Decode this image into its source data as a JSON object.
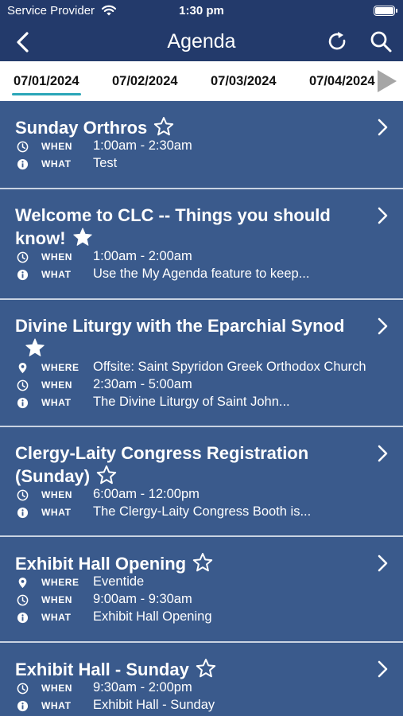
{
  "status_bar": {
    "carrier": "Service Provider",
    "time": "1:30 pm"
  },
  "nav": {
    "title": "Agenda",
    "back_icon": "chevron-left-icon",
    "refresh_icon": "refresh-icon",
    "search_icon": "search-icon"
  },
  "dates": {
    "tabs": [
      "07/01/2024",
      "07/02/2024",
      "07/03/2024",
      "07/04/2024"
    ],
    "active_index": 0
  },
  "labels": {
    "when": "WHEN",
    "what": "WHAT",
    "where": "WHERE"
  },
  "events": [
    {
      "title": "Sunday Orthros",
      "favorite": false,
      "when": "1:00am - 2:30am",
      "what": "Test"
    },
    {
      "title": "Welcome to CLC -- Things you should know!",
      "favorite": true,
      "when": "1:00am - 2:00am",
      "what": "Use the My Agenda feature to keep..."
    },
    {
      "title": "Divine Liturgy with the Eparchial Synod",
      "favorite": true,
      "where": "Offsite: Saint Spyridon Greek Orthodox Church",
      "when": "2:30am - 5:00am",
      "what": "The Divine Liturgy of Saint John..."
    },
    {
      "title": "Clergy-Laity Congress Registration (Sunday)",
      "favorite": false,
      "when": "6:00am - 12:00pm",
      "what": "The Clergy-Laity Congress Booth is..."
    },
    {
      "title": "Exhibit Hall Opening",
      "favorite": false,
      "where": "Eventide",
      "when": "9:00am - 9:30am",
      "what": "Exhibit Hall Opening"
    },
    {
      "title": "Exhibit Hall - Sunday",
      "favorite": false,
      "when": "9:30am - 2:00pm",
      "what": "Exhibit Hall - Sunday"
    }
  ],
  "colors": {
    "header": "#233a6b",
    "card": "#3a5a8c",
    "active_tab_underline": "#2aa6b8"
  }
}
